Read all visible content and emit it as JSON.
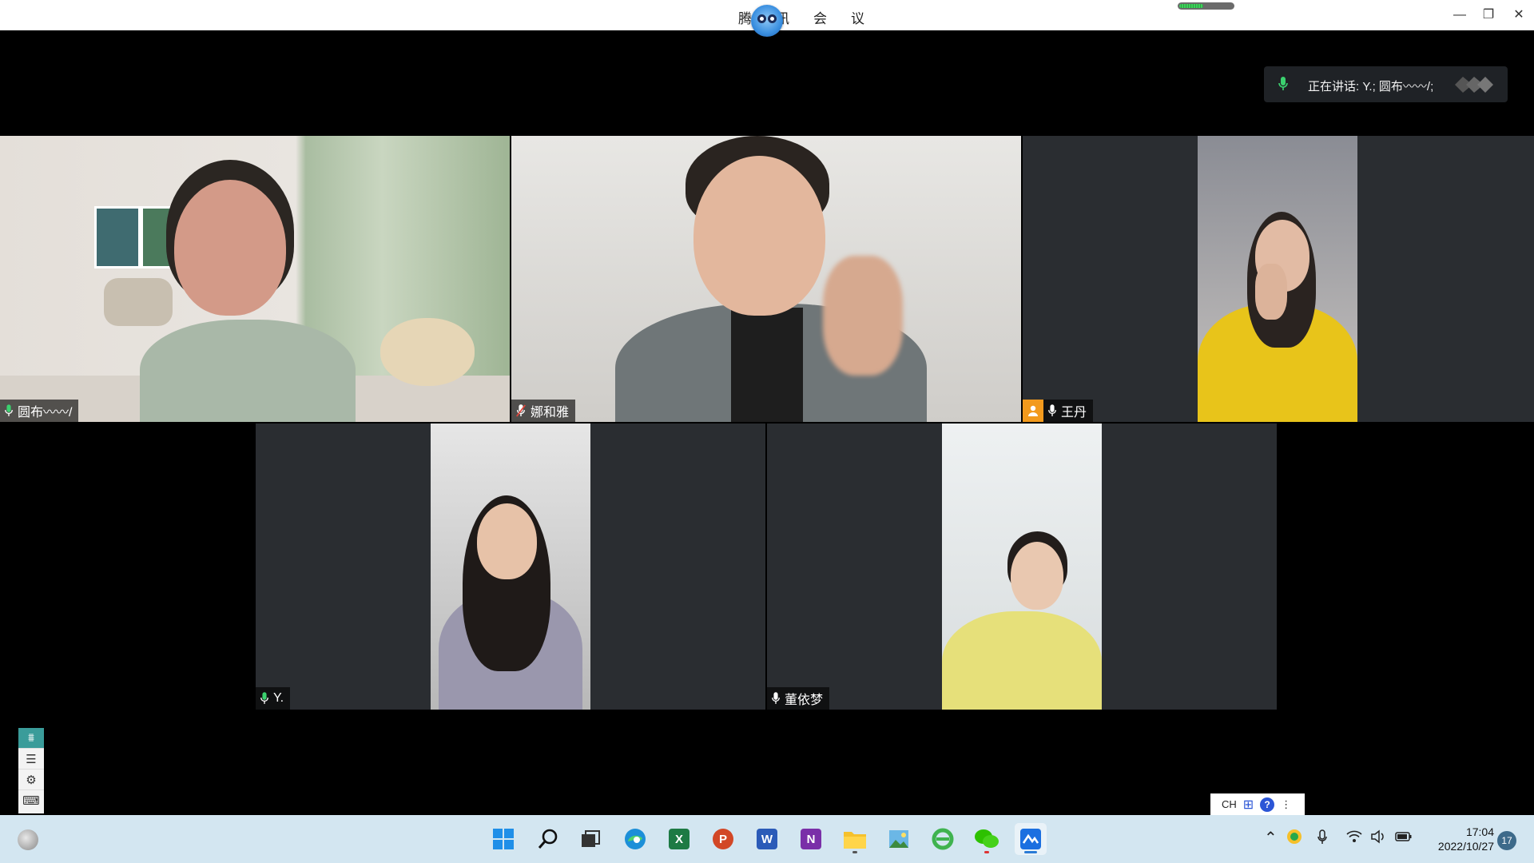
{
  "window": {
    "title": "腾讯会议",
    "progress_fraction": 0.45,
    "controls": {
      "minimize": "—",
      "restore": "❐",
      "close": "✕"
    }
  },
  "speaking": {
    "text": "正在讲话: Y.; 圆布〰〰/;"
  },
  "participants": [
    {
      "name": "圆布〰〰/",
      "mic": "active",
      "host": false
    },
    {
      "name": "娜和雅",
      "mic": "muted",
      "host": false
    },
    {
      "name": "王丹",
      "mic": "on",
      "host": true
    },
    {
      "name": "Y.",
      "mic": "active",
      "host": false
    },
    {
      "name": "董依梦",
      "mic": "on",
      "host": false
    }
  ],
  "ime": {
    "lang": "CH",
    "grid": "⊞",
    "help": "?",
    "extra": "⋮"
  },
  "taskbar": {
    "apps": [
      {
        "icon": "windows-start-icon"
      },
      {
        "icon": "search-icon"
      },
      {
        "icon": "task-view-icon"
      },
      {
        "icon": "edge-icon"
      },
      {
        "icon": "excel-icon",
        "letter": "X"
      },
      {
        "icon": "powerpoint-icon",
        "letter": "P"
      },
      {
        "icon": "word-icon",
        "letter": "W"
      },
      {
        "icon": "onenote-icon",
        "letter": "N"
      },
      {
        "icon": "file-explorer-icon"
      },
      {
        "icon": "photos-icon"
      },
      {
        "icon": "ie-icon"
      },
      {
        "icon": "wechat-icon"
      },
      {
        "icon": "tencent-meeting-icon"
      }
    ],
    "time": "17:04",
    "date": "2022/10/27",
    "notifications": "17"
  }
}
